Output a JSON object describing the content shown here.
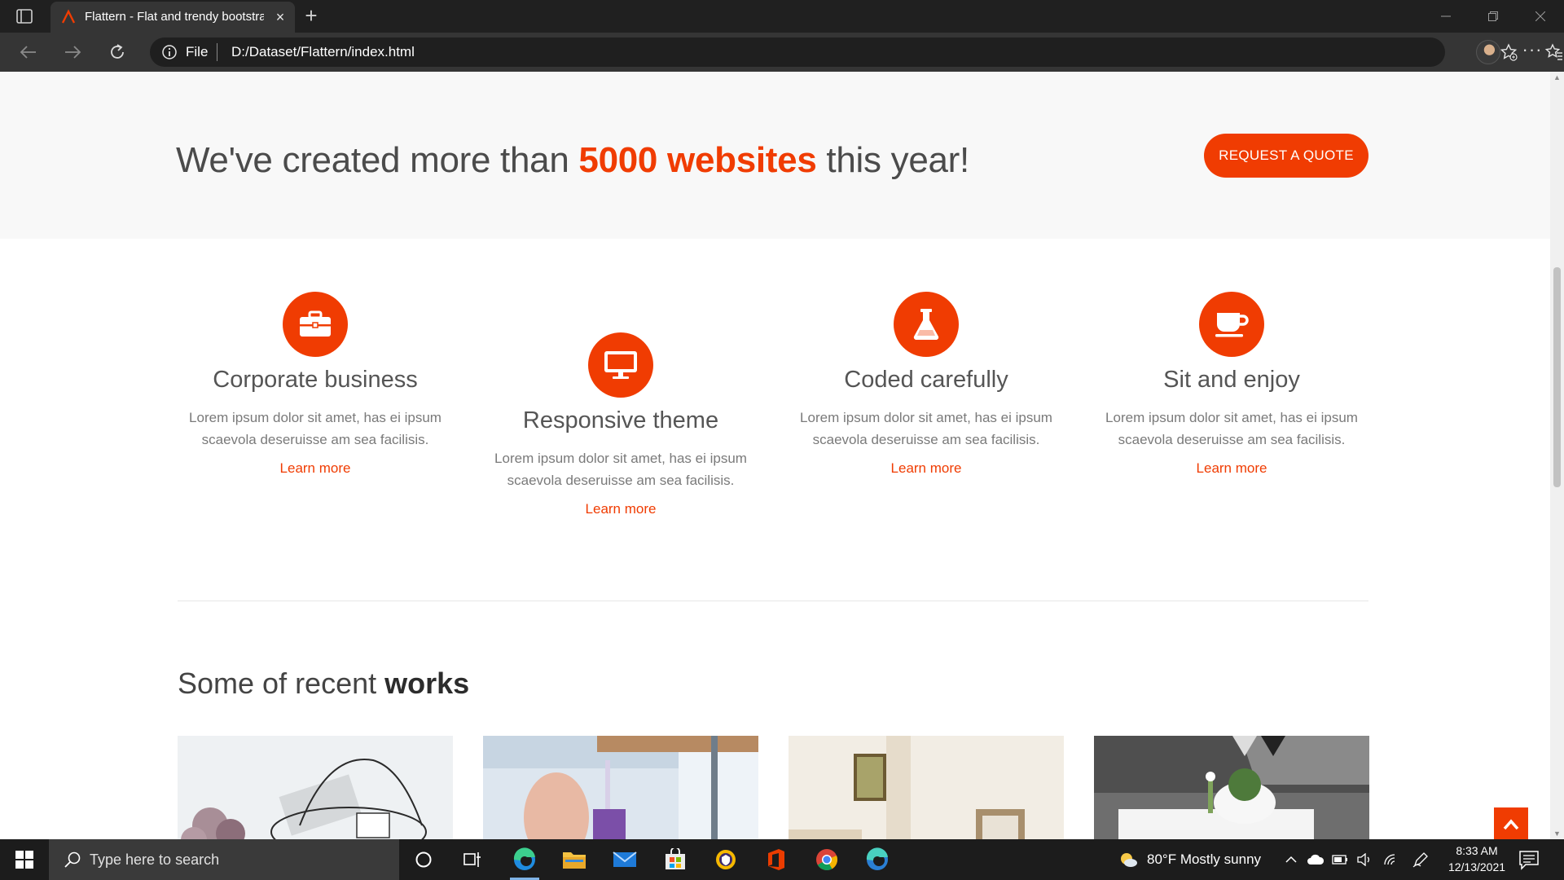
{
  "browser": {
    "tab_title": "Flattern - Flat and trendy bootstrap",
    "tab_close": "×",
    "new_tab": "+",
    "url_scheme_label": "File",
    "url": "D:/Dataset/Flattern/index.html",
    "more_menu": "···"
  },
  "colors": {
    "accent": "#f03c02",
    "chrome_dark": "#202020",
    "chrome_bar": "#353535",
    "taskbar": "#1c1c1c"
  },
  "hero": {
    "heading_before": "We've created more than ",
    "heading_highlight": "5000 websites",
    "heading_after": " this year!",
    "quote_button": "REQUEST A QUOTE"
  },
  "features": [
    {
      "icon": "briefcase-icon",
      "title": "Corporate business",
      "text": "Lorem ipsum dolor sit amet, has ei ipsum scaevola deseruisse am sea facilisis.",
      "link": "Learn more"
    },
    {
      "icon": "desktop-icon",
      "title": "Responsive theme",
      "text": "Lorem ipsum dolor sit amet, has ei ipsum scaevola deseruisse am sea facilisis.",
      "link": "Learn more"
    },
    {
      "icon": "flask-icon",
      "title": "Coded carefully",
      "text": "Lorem ipsum dolor sit amet, has ei ipsum scaevola deseruisse am sea facilisis.",
      "link": "Learn more"
    },
    {
      "icon": "coffee-icon",
      "title": "Sit and enjoy",
      "text": "Lorem ipsum dolor sit amet, has ei ipsum scaevola deseruisse am sea facilisis.",
      "link": "Learn more"
    }
  ],
  "works": {
    "heading_before": "Some of recent ",
    "heading_bold": "works"
  },
  "taskbar": {
    "search_placeholder": "Type here to search",
    "weather": "80°F  Mostly sunny",
    "time": "8:33 AM",
    "date": "12/13/2021"
  }
}
